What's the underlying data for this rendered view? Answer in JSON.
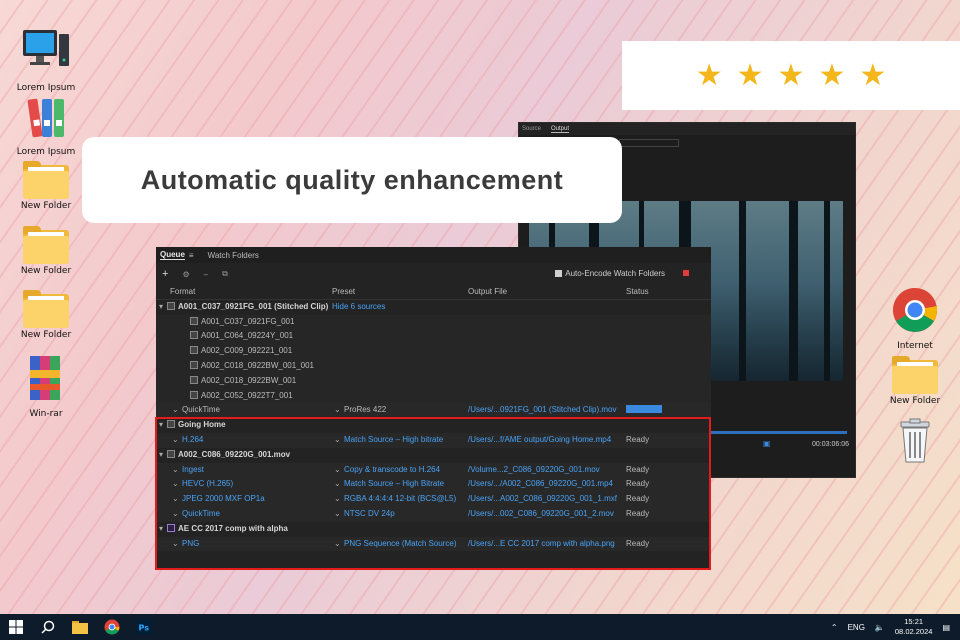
{
  "desktop_left": [
    {
      "label": "Lorem Ipsum",
      "icon": "computer-icon"
    },
    {
      "label": "Lorem Ipsum",
      "icon": "binders-icon"
    },
    {
      "label": "New Folder",
      "icon": "folder-icon"
    },
    {
      "label": "New Folder",
      "icon": "folder-icon"
    },
    {
      "label": "New Folder",
      "icon": "folder-icon"
    },
    {
      "label": "Win-rar",
      "icon": "winrar-icon"
    }
  ],
  "desktop_right": [
    {
      "label": "Internet",
      "icon": "chrome-icon"
    },
    {
      "label": "New Folder",
      "icon": "folder-icon"
    },
    {
      "label": "",
      "icon": "recycle-bin-icon"
    }
  ],
  "rating": {
    "stars": 5,
    "symbol": "★",
    "color": "#f3b71c"
  },
  "headline": "Automatic quality enhancement",
  "preview": {
    "tabs": [
      "Source",
      "Output"
    ],
    "timecode": "00:03:06:06"
  },
  "queue": {
    "tabs": [
      "Queue",
      "Watch Folders"
    ],
    "auto_encode_label": "Auto-Encode Watch Folders",
    "columns": [
      "Format",
      "Preset",
      "Output File",
      "Status"
    ],
    "rows": [
      {
        "type": "group",
        "format": "A001_C037_0921FG_001 (Stitched Clip)",
        "preset": "Hide 6 sources",
        "output": "",
        "status": ""
      },
      {
        "type": "sub",
        "format": "A001_C037_0921FG_001"
      },
      {
        "type": "sub",
        "format": "A001_C064_09224Y_001"
      },
      {
        "type": "sub",
        "format": "A002_C009_092221_001"
      },
      {
        "type": "sub",
        "format": "A002_C018_0922BW_001_001"
      },
      {
        "type": "sub",
        "format": "A002_C018_0922BW_001"
      },
      {
        "type": "sub",
        "format": "A002_C052_0922T7_001"
      },
      {
        "type": "item",
        "format": "QuickTime",
        "preset": "ProRes 422",
        "output": "/Users/...0921FG_001 (Stitched Clip).mov",
        "status": ""
      },
      {
        "type": "group",
        "format": "Going Home",
        "preset": "",
        "output": "",
        "status": ""
      },
      {
        "type": "item",
        "format": "H.264",
        "preset": "Match Source – High bitrate",
        "output": "/Users/...f/AME output/Going Home.mp4",
        "status": "Ready"
      },
      {
        "type": "group",
        "format": "A002_C086_09220G_001.mov",
        "preset": "",
        "output": "",
        "status": ""
      },
      {
        "type": "item",
        "format": "Ingest",
        "preset": "Copy & transcode to H.264",
        "output": "/Volume...2_C086_09220G_001.mov",
        "status": "Ready"
      },
      {
        "type": "item",
        "format": "HEVC (H.265)",
        "preset": "Match Source – High Bitrate",
        "output": "/Users/.../A002_C086_09220G_001.mp4",
        "status": "Ready"
      },
      {
        "type": "item",
        "format": "JPEG 2000 MXF OP1a",
        "preset": "RGBA 4:4:4:4 12-bit (BCS@L5)",
        "output": "/Users/...A002_C086_09220G_001_1.mxf",
        "status": "Ready"
      },
      {
        "type": "item",
        "format": "QuickTime",
        "preset": "NTSC DV 24p",
        "output": "/Users/...002_C086_09220G_001_2.mov",
        "status": "Ready"
      },
      {
        "type": "group",
        "format": "AE CC 2017 comp with alpha",
        "preset": "",
        "output": "",
        "status": ""
      },
      {
        "type": "item",
        "format": "PNG",
        "preset": "PNG Sequence (Match Source)",
        "output": "/Users/...E CC 2017 comp with alpha.png",
        "status": "Ready"
      }
    ]
  },
  "taskbar": {
    "lang": "ENG",
    "time": "15:21",
    "date": "08.02.2024"
  }
}
